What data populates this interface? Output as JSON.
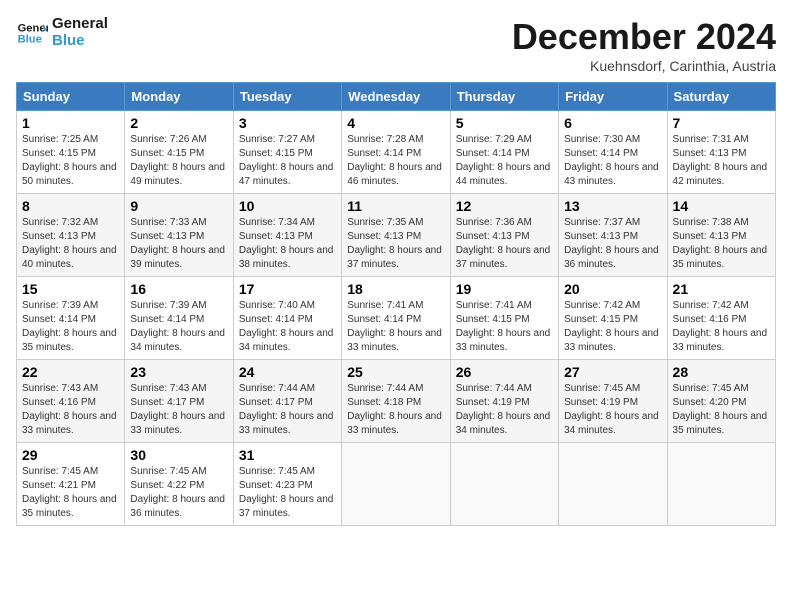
{
  "logo": {
    "line1": "General",
    "line2": "Blue"
  },
  "title": "December 2024",
  "subtitle": "Kuehnsdorf, Carinthia, Austria",
  "header_days": [
    "Sunday",
    "Monday",
    "Tuesday",
    "Wednesday",
    "Thursday",
    "Friday",
    "Saturday"
  ],
  "weeks": [
    [
      {
        "day": "1",
        "rise": "Sunrise: 7:25 AM",
        "set": "Sunset: 4:15 PM",
        "daylight": "Daylight: 8 hours and 50 minutes."
      },
      {
        "day": "2",
        "rise": "Sunrise: 7:26 AM",
        "set": "Sunset: 4:15 PM",
        "daylight": "Daylight: 8 hours and 49 minutes."
      },
      {
        "day": "3",
        "rise": "Sunrise: 7:27 AM",
        "set": "Sunset: 4:15 PM",
        "daylight": "Daylight: 8 hours and 47 minutes."
      },
      {
        "day": "4",
        "rise": "Sunrise: 7:28 AM",
        "set": "Sunset: 4:14 PM",
        "daylight": "Daylight: 8 hours and 46 minutes."
      },
      {
        "day": "5",
        "rise": "Sunrise: 7:29 AM",
        "set": "Sunset: 4:14 PM",
        "daylight": "Daylight: 8 hours and 44 minutes."
      },
      {
        "day": "6",
        "rise": "Sunrise: 7:30 AM",
        "set": "Sunset: 4:14 PM",
        "daylight": "Daylight: 8 hours and 43 minutes."
      },
      {
        "day": "7",
        "rise": "Sunrise: 7:31 AM",
        "set": "Sunset: 4:13 PM",
        "daylight": "Daylight: 8 hours and 42 minutes."
      }
    ],
    [
      {
        "day": "8",
        "rise": "Sunrise: 7:32 AM",
        "set": "Sunset: 4:13 PM",
        "daylight": "Daylight: 8 hours and 40 minutes."
      },
      {
        "day": "9",
        "rise": "Sunrise: 7:33 AM",
        "set": "Sunset: 4:13 PM",
        "daylight": "Daylight: 8 hours and 39 minutes."
      },
      {
        "day": "10",
        "rise": "Sunrise: 7:34 AM",
        "set": "Sunset: 4:13 PM",
        "daylight": "Daylight: 8 hours and 38 minutes."
      },
      {
        "day": "11",
        "rise": "Sunrise: 7:35 AM",
        "set": "Sunset: 4:13 PM",
        "daylight": "Daylight: 8 hours and 37 minutes."
      },
      {
        "day": "12",
        "rise": "Sunrise: 7:36 AM",
        "set": "Sunset: 4:13 PM",
        "daylight": "Daylight: 8 hours and 37 minutes."
      },
      {
        "day": "13",
        "rise": "Sunrise: 7:37 AM",
        "set": "Sunset: 4:13 PM",
        "daylight": "Daylight: 8 hours and 36 minutes."
      },
      {
        "day": "14",
        "rise": "Sunrise: 7:38 AM",
        "set": "Sunset: 4:13 PM",
        "daylight": "Daylight: 8 hours and 35 minutes."
      }
    ],
    [
      {
        "day": "15",
        "rise": "Sunrise: 7:39 AM",
        "set": "Sunset: 4:14 PM",
        "daylight": "Daylight: 8 hours and 35 minutes."
      },
      {
        "day": "16",
        "rise": "Sunrise: 7:39 AM",
        "set": "Sunset: 4:14 PM",
        "daylight": "Daylight: 8 hours and 34 minutes."
      },
      {
        "day": "17",
        "rise": "Sunrise: 7:40 AM",
        "set": "Sunset: 4:14 PM",
        "daylight": "Daylight: 8 hours and 34 minutes."
      },
      {
        "day": "18",
        "rise": "Sunrise: 7:41 AM",
        "set": "Sunset: 4:14 PM",
        "daylight": "Daylight: 8 hours and 33 minutes."
      },
      {
        "day": "19",
        "rise": "Sunrise: 7:41 AM",
        "set": "Sunset: 4:15 PM",
        "daylight": "Daylight: 8 hours and 33 minutes."
      },
      {
        "day": "20",
        "rise": "Sunrise: 7:42 AM",
        "set": "Sunset: 4:15 PM",
        "daylight": "Daylight: 8 hours and 33 minutes."
      },
      {
        "day": "21",
        "rise": "Sunrise: 7:42 AM",
        "set": "Sunset: 4:16 PM",
        "daylight": "Daylight: 8 hours and 33 minutes."
      }
    ],
    [
      {
        "day": "22",
        "rise": "Sunrise: 7:43 AM",
        "set": "Sunset: 4:16 PM",
        "daylight": "Daylight: 8 hours and 33 minutes."
      },
      {
        "day": "23",
        "rise": "Sunrise: 7:43 AM",
        "set": "Sunset: 4:17 PM",
        "daylight": "Daylight: 8 hours and 33 minutes."
      },
      {
        "day": "24",
        "rise": "Sunrise: 7:44 AM",
        "set": "Sunset: 4:17 PM",
        "daylight": "Daylight: 8 hours and 33 minutes."
      },
      {
        "day": "25",
        "rise": "Sunrise: 7:44 AM",
        "set": "Sunset: 4:18 PM",
        "daylight": "Daylight: 8 hours and 33 minutes."
      },
      {
        "day": "26",
        "rise": "Sunrise: 7:44 AM",
        "set": "Sunset: 4:19 PM",
        "daylight": "Daylight: 8 hours and 34 minutes."
      },
      {
        "day": "27",
        "rise": "Sunrise: 7:45 AM",
        "set": "Sunset: 4:19 PM",
        "daylight": "Daylight: 8 hours and 34 minutes."
      },
      {
        "day": "28",
        "rise": "Sunrise: 7:45 AM",
        "set": "Sunset: 4:20 PM",
        "daylight": "Daylight: 8 hours and 35 minutes."
      }
    ],
    [
      {
        "day": "29",
        "rise": "Sunrise: 7:45 AM",
        "set": "Sunset: 4:21 PM",
        "daylight": "Daylight: 8 hours and 35 minutes."
      },
      {
        "day": "30",
        "rise": "Sunrise: 7:45 AM",
        "set": "Sunset: 4:22 PM",
        "daylight": "Daylight: 8 hours and 36 minutes."
      },
      {
        "day": "31",
        "rise": "Sunrise: 7:45 AM",
        "set": "Sunset: 4:23 PM",
        "daylight": "Daylight: 8 hours and 37 minutes."
      },
      null,
      null,
      null,
      null
    ]
  ]
}
